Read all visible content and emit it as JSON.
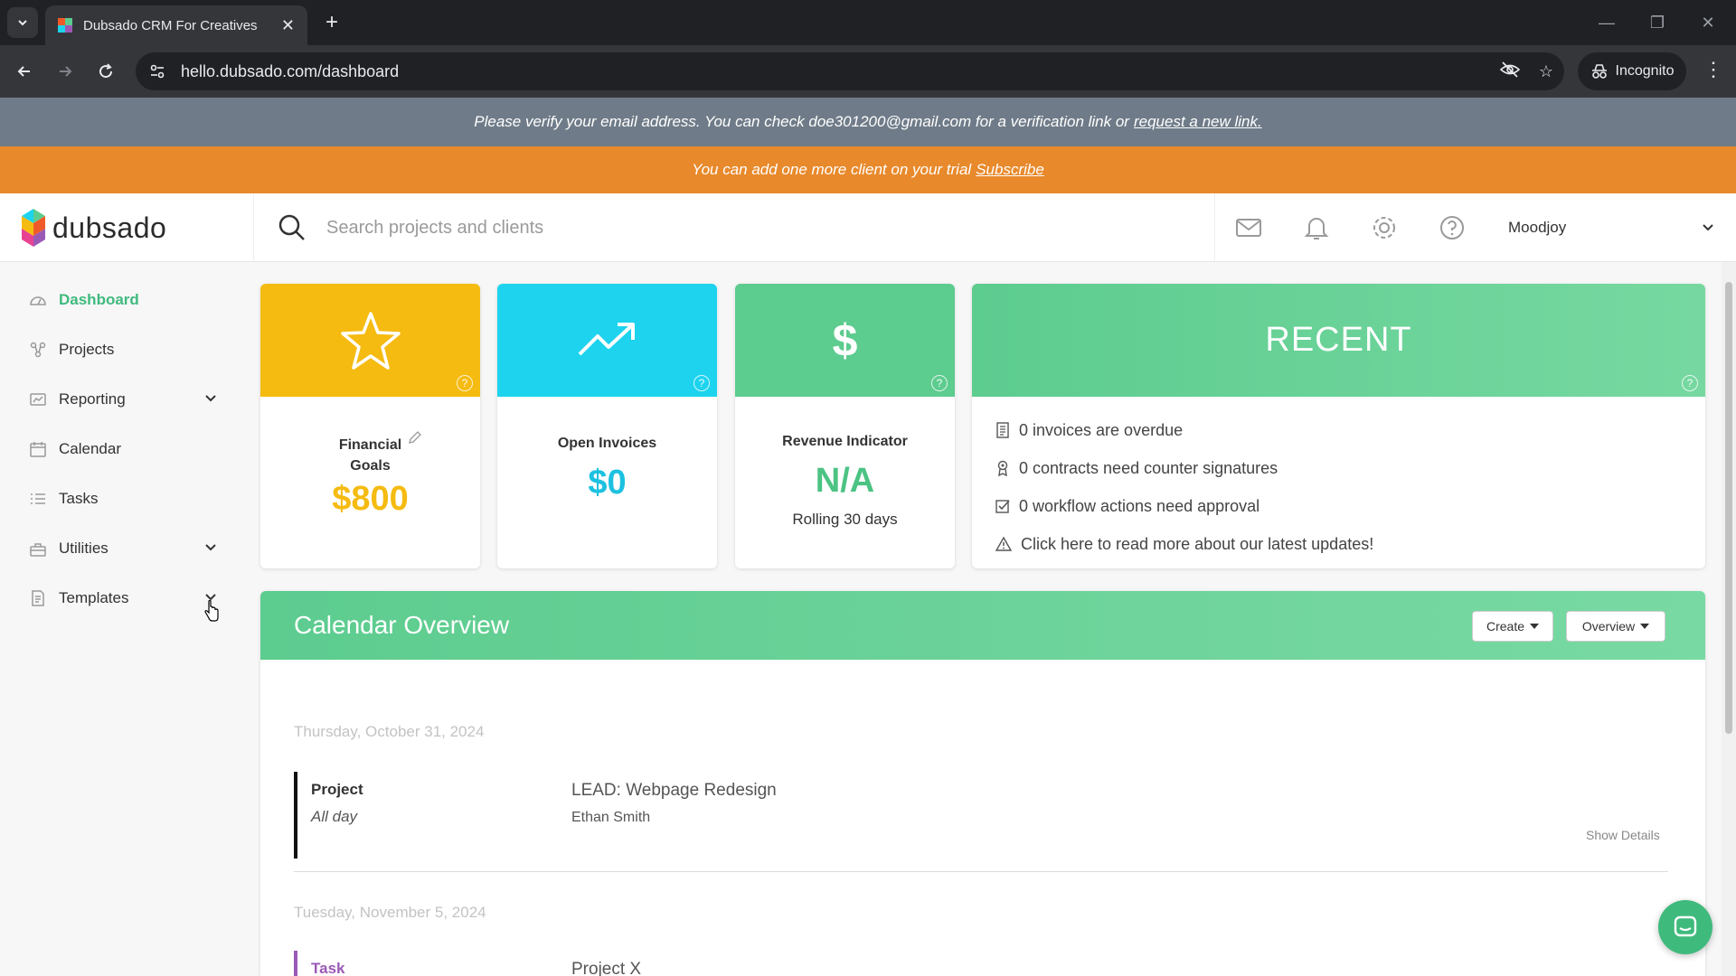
{
  "browser": {
    "tab_title": "Dubsado CRM For Creatives",
    "url": "hello.dubsado.com/dashboard",
    "incognito_label": "Incognito"
  },
  "banners": {
    "verify_text": "Please verify your email address. You can check doe301200@gmail.com for a verification link or",
    "verify_link": "request a new link.",
    "trial_text": "You can add one more client on your trial",
    "trial_link": "Subscribe"
  },
  "header": {
    "logo_text": "dubsado",
    "search_placeholder": "Search projects and clients",
    "user_name": "Moodjoy"
  },
  "sidebar": {
    "items": [
      {
        "label": "Dashboard"
      },
      {
        "label": "Projects"
      },
      {
        "label": "Reporting"
      },
      {
        "label": "Calendar"
      },
      {
        "label": "Tasks"
      },
      {
        "label": "Utilities"
      },
      {
        "label": "Templates"
      }
    ]
  },
  "cards": {
    "financial": {
      "label_line1": "Financial",
      "label_line2": "Goals",
      "value": "$800",
      "color": "#f5bb11"
    },
    "invoices": {
      "label": "Open Invoices",
      "value": "$0",
      "color": "#1dd3ee"
    },
    "revenue": {
      "label": "Revenue Indicator",
      "value": "N/A",
      "sub": "Rolling 30 days",
      "color": "#5dcc8f"
    },
    "recent": {
      "title": "RECENT",
      "items": [
        "0 invoices are overdue",
        "0 contracts need counter signatures",
        "0 workflow actions need approval",
        "Click here to read more about our latest updates!"
      ]
    }
  },
  "calendar": {
    "title": "Calendar Overview",
    "create_label": "Create",
    "overview_label": "Overview",
    "groups": [
      {
        "date": "Thursday, October 31, 2024",
        "type": "Project",
        "sub": "All day",
        "name": "LEAD: Webpage Redesign",
        "client": "Ethan Smith",
        "details": "Show Details"
      },
      {
        "date": "Tuesday, November 5, 2024",
        "type": "Task",
        "name": "Project X"
      }
    ]
  }
}
